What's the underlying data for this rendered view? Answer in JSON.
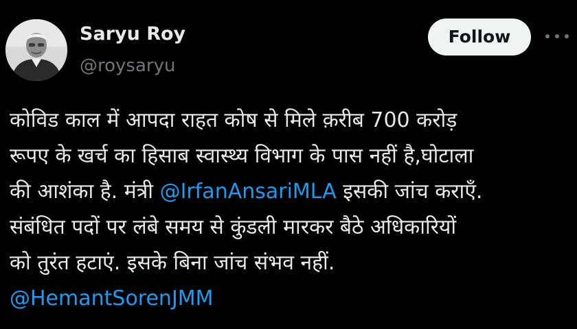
{
  "author": {
    "display_name": "Saryu Roy",
    "handle": "@roysaryu",
    "avatar": "profile-photo"
  },
  "actions": {
    "follow_label": "Follow",
    "more_icon": "ellipsis-horizontal-icon"
  },
  "tweet": {
    "lines": [
      {
        "text": "कोविड काल में आपदा राहत कोष से मिले क़रीब 700 करोड़"
      },
      {
        "text": "रूपए के खर्च का हिसाब स्वास्थ्य विभाग के पास नहीं है,घोटाला"
      },
      {
        "before": "की आशंका है. मंत्री ",
        "mention": "@IrfanAnsariMLA",
        "after": " इसकी जांच कराएँ."
      },
      {
        "text": "संबंधित पदों पर लंबे समय से कुंडली मारकर बैठे अधिकारियों"
      },
      {
        "text": "को तुरंत हटाएं. इसके बिना जांच संभव नहीं."
      },
      {
        "mention": "@HemantSorenJMM"
      }
    ]
  },
  "colors": {
    "background": "#000000",
    "text": "#e7e9ea",
    "secondary": "#71767b",
    "link": "#1d9bf0",
    "follow_bg": "#eff3f4"
  }
}
